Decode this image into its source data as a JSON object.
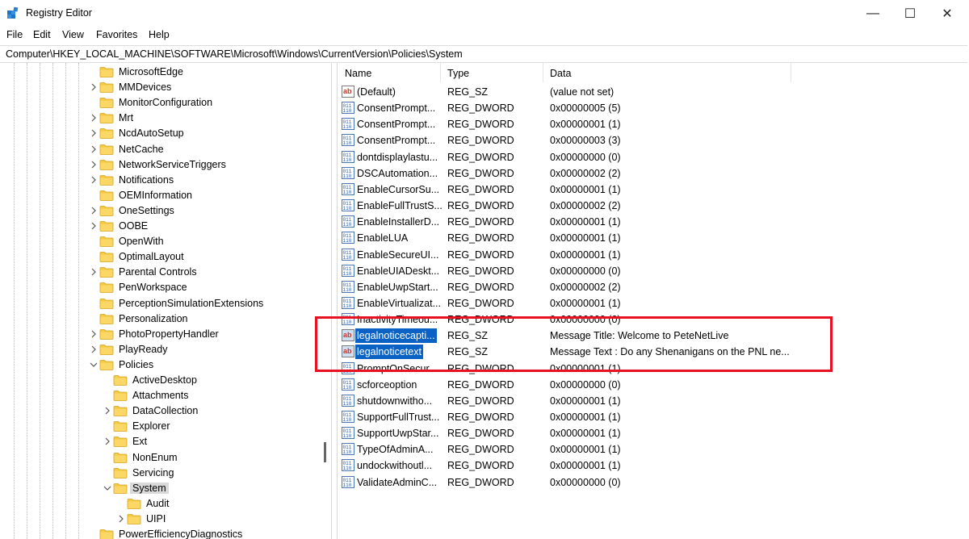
{
  "window": {
    "title": "Registry Editor",
    "controls": {
      "minimize": "—",
      "maximize": "☐",
      "close": "✕"
    }
  },
  "menu": [
    "File",
    "Edit",
    "View",
    "Favorites",
    "Help"
  ],
  "address": "Computer\\HKEY_LOCAL_MACHINE\\SOFTWARE\\Microsoft\\Windows\\CurrentVersion\\Policies\\System",
  "tree": [
    {
      "label": "MicrosoftEdge",
      "level": 0,
      "expander": "none"
    },
    {
      "label": "MMDevices",
      "level": 0,
      "expander": "collapsed"
    },
    {
      "label": "MonitorConfiguration",
      "level": 0,
      "expander": "none"
    },
    {
      "label": "Mrt",
      "level": 0,
      "expander": "collapsed"
    },
    {
      "label": "NcdAutoSetup",
      "level": 0,
      "expander": "collapsed"
    },
    {
      "label": "NetCache",
      "level": 0,
      "expander": "collapsed"
    },
    {
      "label": "NetworkServiceTriggers",
      "level": 0,
      "expander": "collapsed"
    },
    {
      "label": "Notifications",
      "level": 0,
      "expander": "collapsed"
    },
    {
      "label": "OEMInformation",
      "level": 0,
      "expander": "none"
    },
    {
      "label": "OneSettings",
      "level": 0,
      "expander": "collapsed"
    },
    {
      "label": "OOBE",
      "level": 0,
      "expander": "collapsed"
    },
    {
      "label": "OpenWith",
      "level": 0,
      "expander": "none"
    },
    {
      "label": "OptimalLayout",
      "level": 0,
      "expander": "none"
    },
    {
      "label": "Parental Controls",
      "level": 0,
      "expander": "collapsed"
    },
    {
      "label": "PenWorkspace",
      "level": 0,
      "expander": "none"
    },
    {
      "label": "PerceptionSimulationExtensions",
      "level": 0,
      "expander": "none"
    },
    {
      "label": "Personalization",
      "level": 0,
      "expander": "none"
    },
    {
      "label": "PhotoPropertyHandler",
      "level": 0,
      "expander": "collapsed"
    },
    {
      "label": "PlayReady",
      "level": 0,
      "expander": "collapsed"
    },
    {
      "label": "Policies",
      "level": 0,
      "expander": "expanded"
    },
    {
      "label": "ActiveDesktop",
      "level": 1,
      "expander": "none"
    },
    {
      "label": "Attachments",
      "level": 1,
      "expander": "none"
    },
    {
      "label": "DataCollection",
      "level": 1,
      "expander": "collapsed"
    },
    {
      "label": "Explorer",
      "level": 1,
      "expander": "none"
    },
    {
      "label": "Ext",
      "level": 1,
      "expander": "collapsed"
    },
    {
      "label": "NonEnum",
      "level": 1,
      "expander": "none"
    },
    {
      "label": "Servicing",
      "level": 1,
      "expander": "none"
    },
    {
      "label": "System",
      "level": 1,
      "expander": "expanded",
      "selected": true
    },
    {
      "label": "Audit",
      "level": 2,
      "expander": "none"
    },
    {
      "label": "UIPI",
      "level": 2,
      "expander": "collapsed"
    },
    {
      "label": "PowerEfficiencyDiagnostics",
      "level": 0,
      "expander": "none"
    }
  ],
  "columns": {
    "name": "Name",
    "type": "Type",
    "data": "Data"
  },
  "values": [
    {
      "icon": "string-value-icon",
      "name": "(Default)",
      "type": "REG_SZ",
      "data": "(value not set)"
    },
    {
      "icon": "dword-value-icon",
      "name": "ConsentPrompt...",
      "type": "REG_DWORD",
      "data": "0x00000005 (5)"
    },
    {
      "icon": "dword-value-icon",
      "name": "ConsentPrompt...",
      "type": "REG_DWORD",
      "data": "0x00000001 (1)"
    },
    {
      "icon": "dword-value-icon",
      "name": "ConsentPrompt...",
      "type": "REG_DWORD",
      "data": "0x00000003 (3)"
    },
    {
      "icon": "dword-value-icon",
      "name": "dontdisplaylastu...",
      "type": "REG_DWORD",
      "data": "0x00000000 (0)"
    },
    {
      "icon": "dword-value-icon",
      "name": "DSCAutomation...",
      "type": "REG_DWORD",
      "data": "0x00000002 (2)"
    },
    {
      "icon": "dword-value-icon",
      "name": "EnableCursorSu...",
      "type": "REG_DWORD",
      "data": "0x00000001 (1)"
    },
    {
      "icon": "dword-value-icon",
      "name": "EnableFullTrustS...",
      "type": "REG_DWORD",
      "data": "0x00000002 (2)"
    },
    {
      "icon": "dword-value-icon",
      "name": "EnableInstallerD...",
      "type": "REG_DWORD",
      "data": "0x00000001 (1)"
    },
    {
      "icon": "dword-value-icon",
      "name": "EnableLUA",
      "type": "REG_DWORD",
      "data": "0x00000001 (1)"
    },
    {
      "icon": "dword-value-icon",
      "name": "EnableSecureUI...",
      "type": "REG_DWORD",
      "data": "0x00000001 (1)"
    },
    {
      "icon": "dword-value-icon",
      "name": "EnableUIADeskt...",
      "type": "REG_DWORD",
      "data": "0x00000000 (0)"
    },
    {
      "icon": "dword-value-icon",
      "name": "EnableUwpStart...",
      "type": "REG_DWORD",
      "data": "0x00000002 (2)"
    },
    {
      "icon": "dword-value-icon",
      "name": "EnableVirtualizat...",
      "type": "REG_DWORD",
      "data": "0x00000001 (1)"
    },
    {
      "icon": "dword-value-icon",
      "name": "InactivityTimeou...",
      "type": "REG_DWORD",
      "data": "0x00000000 (0)"
    },
    {
      "icon": "string-value-icon",
      "name": "legalnoticecapti...",
      "type": "REG_SZ",
      "data": "Message Title: Welcome to PeteNetLive",
      "selected": true
    },
    {
      "icon": "string-value-icon",
      "name": "legalnoticetext",
      "type": "REG_SZ",
      "data": "Message Text : Do any Shenanigans on the PNL ne...",
      "selected": true
    },
    {
      "icon": "dword-value-icon",
      "name": "PromptOnSecur...",
      "type": "REG_DWORD",
      "data": "0x00000001 (1)"
    },
    {
      "icon": "dword-value-icon",
      "name": "scforceoption",
      "type": "REG_DWORD",
      "data": "0x00000000 (0)"
    },
    {
      "icon": "dword-value-icon",
      "name": "shutdownwitho...",
      "type": "REG_DWORD",
      "data": "0x00000001 (1)"
    },
    {
      "icon": "dword-value-icon",
      "name": "SupportFullTrust...",
      "type": "REG_DWORD",
      "data": "0x00000001 (1)"
    },
    {
      "icon": "dword-value-icon",
      "name": "SupportUwpStar...",
      "type": "REG_DWORD",
      "data": "0x00000001 (1)"
    },
    {
      "icon": "dword-value-icon",
      "name": "TypeOfAdminA...",
      "type": "REG_DWORD",
      "data": "0x00000001 (1)"
    },
    {
      "icon": "dword-value-icon",
      "name": "undockwithoutl...",
      "type": "REG_DWORD",
      "data": "0x00000001 (1)"
    },
    {
      "icon": "dword-value-icon",
      "name": "ValidateAdminC...",
      "type": "REG_DWORD",
      "data": "0x00000000 (0)"
    }
  ],
  "colors": {
    "highlight_border": "#e81122",
    "selection": "#0a63c4",
    "folder": "#f5c842"
  }
}
